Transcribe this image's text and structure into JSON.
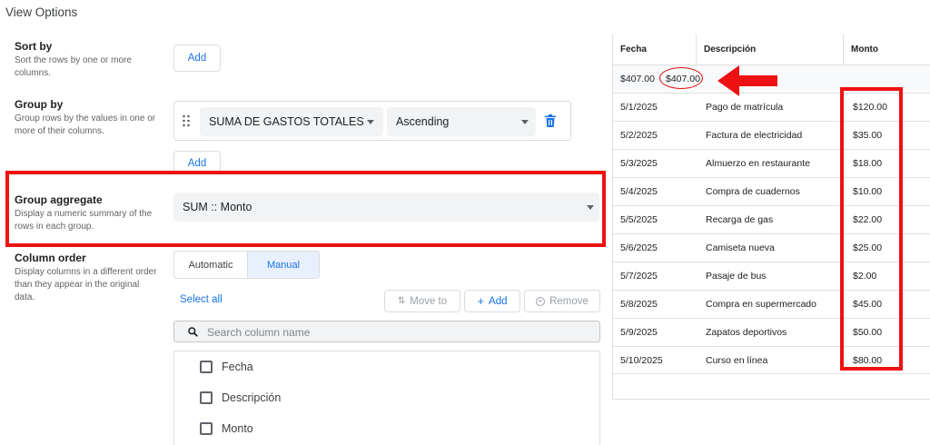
{
  "header": {
    "title": "View Options"
  },
  "sort": {
    "title": "Sort by",
    "desc_line1": "Sort the rows by one or more",
    "desc_line2": "columns.",
    "add_label": "Add"
  },
  "group": {
    "title": "Group by",
    "desc_line1": "Group rows by the values in one or",
    "desc_line2": "more of their columns.",
    "column_value": "SUMA DE GASTOS TOTALES",
    "order_value": "Ascending",
    "add_label": "Add"
  },
  "aggregate": {
    "title": "Group aggregate",
    "desc_line1": "Display a numeric summary of the",
    "desc_line2": "rows in each group.",
    "value": "SUM :: Monto"
  },
  "column_order": {
    "title": "Column order",
    "desc_line1": "Display columns in a different order",
    "desc_line2": "than they appear in the original",
    "desc_line3": "data.",
    "tab_automatic": "Automatic",
    "tab_manual": "Manual",
    "select_all": "Select all",
    "move_to": "Move to",
    "add": "Add",
    "remove": "Remove",
    "search_placeholder": "Search column name",
    "columns": [
      "Fecha",
      "Descripción",
      "Monto"
    ]
  },
  "table": {
    "headers": [
      "Fecha",
      "Descripción",
      "Monto"
    ],
    "group_row": {
      "total_left": "$407.00",
      "total_circled": "$407.00"
    },
    "rows": [
      {
        "fecha": "5/1/2025",
        "desc": "Pago de matrícula",
        "monto": "$120.00"
      },
      {
        "fecha": "5/2/2025",
        "desc": "Factura de electricidad",
        "monto": "$35.00"
      },
      {
        "fecha": "5/3/2025",
        "desc": "Almuerzo en restaurante",
        "monto": "$18.00"
      },
      {
        "fecha": "5/4/2025",
        "desc": "Compra de cuadernos",
        "monto": "$10.00"
      },
      {
        "fecha": "5/5/2025",
        "desc": "Recarga de gas",
        "monto": "$22.00"
      },
      {
        "fecha": "5/6/2025",
        "desc": "Camiseta nueva",
        "monto": "$25.00"
      },
      {
        "fecha": "5/7/2025",
        "desc": "Pasaje de bus",
        "monto": "$2.00"
      },
      {
        "fecha": "5/8/2025",
        "desc": "Compra en supermercado",
        "monto": "$45.00"
      },
      {
        "fecha": "5/9/2025",
        "desc": "Zapatos deportivos",
        "monto": "$50.00"
      },
      {
        "fecha": "5/10/2025",
        "desc": "Curso en línea",
        "monto": "$80.00"
      }
    ]
  },
  "colors": {
    "accent": "#1a73e8",
    "annotation": "#ee1111",
    "manual_tab_bg": "#e8f0fe"
  }
}
